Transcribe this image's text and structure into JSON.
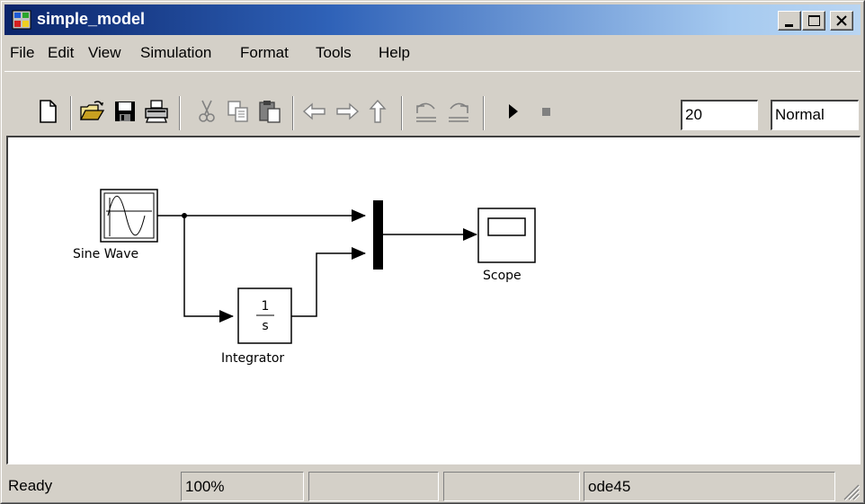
{
  "window": {
    "title": "simple_model",
    "icon": "simulink-model-icon",
    "controls": [
      "minimize-icon",
      "maximize-icon",
      "close-icon"
    ]
  },
  "menu": {
    "items": [
      "File",
      "Edit",
      "View",
      "Simulation",
      "Format",
      "Tools",
      "Help"
    ]
  },
  "toolbar": {
    "buttons": [
      "new-model-icon",
      "open-folder-icon",
      "save-icon",
      "print-icon",
      "cut-icon",
      "copy-icon",
      "paste-icon",
      "back-icon",
      "forward-icon",
      "up-icon",
      "undo-icon",
      "redo-icon",
      "start-simulation-icon",
      "stop-simulation-icon"
    ],
    "stop_time": "20",
    "sim_mode": "Normal"
  },
  "diagram": {
    "blocks": {
      "sine_wave": {
        "label": "Sine Wave"
      },
      "integrator": {
        "label": "Integrator",
        "numerator": "1",
        "denominator": "s"
      },
      "mux": {
        "label": ""
      },
      "scope": {
        "label": "Scope"
      }
    }
  },
  "status": {
    "state": "Ready",
    "zoom": "100%",
    "pane3": "",
    "pane4": "",
    "solver": "ode45"
  }
}
